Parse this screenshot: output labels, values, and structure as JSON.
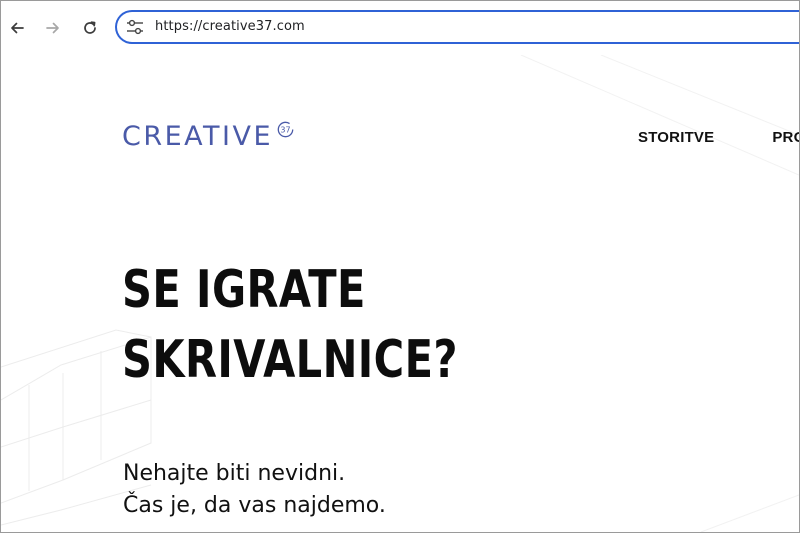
{
  "browser": {
    "url": "https://creative37.com",
    "icons": {
      "back": "arrow-left-icon",
      "forward": "arrow-right-icon",
      "reload": "reload-icon",
      "site_info": "tune-icon"
    }
  },
  "site": {
    "logo_text": "CREATIVE",
    "logo_mark": "37",
    "nav": [
      "STORITVE",
      "PRO"
    ],
    "headline": [
      "SE IGRATE",
      "SKRIVALNICE?"
    ],
    "subheadline": [
      "Nehajte biti nevidni.",
      "Čas je, da vas najdemo."
    ]
  },
  "colors": {
    "accent": "#2f62d6",
    "logo": "#4a5aa8",
    "text": "#111111"
  }
}
